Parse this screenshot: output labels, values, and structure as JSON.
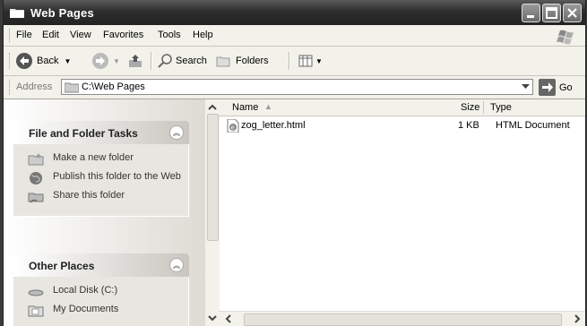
{
  "window": {
    "title": "Web Pages"
  },
  "menu": {
    "items": [
      "File",
      "Edit",
      "View",
      "Favorites",
      "Tools",
      "Help"
    ]
  },
  "toolbar": {
    "back_label": "Back",
    "search_label": "Search",
    "folders_label": "Folders"
  },
  "address": {
    "label": "Address",
    "value": "C:\\Web Pages",
    "go_label": "Go"
  },
  "tasks_panel": {
    "title": "File and Folder Tasks",
    "items": [
      "Make a new folder",
      "Publish this folder to the Web",
      "Share this folder"
    ]
  },
  "places_panel": {
    "title": "Other Places",
    "items": [
      "Local Disk (C:)",
      "My Documents"
    ]
  },
  "columns": {
    "name": "Name",
    "size": "Size",
    "type": "Type"
  },
  "files": [
    {
      "name": "zog_letter.html",
      "size": "1 KB",
      "type": "HTML Document"
    }
  ],
  "icons": {
    "window": "folder-icon",
    "back": "back-arrow-icon",
    "forward": "forward-arrow-icon",
    "up": "up-folder-icon",
    "search": "search-icon",
    "folders": "folders-icon",
    "views": "views-icon",
    "go": "go-arrow-icon"
  }
}
